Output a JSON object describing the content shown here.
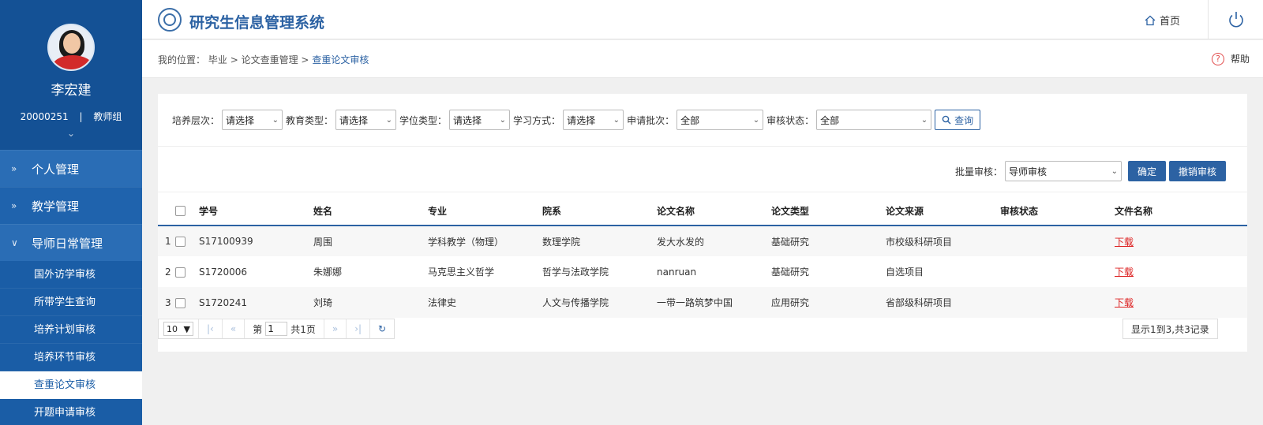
{
  "app_title": "研究生信息管理系统",
  "header": {
    "home_label": "首页",
    "help_label": "帮助"
  },
  "user": {
    "name": "李宏建",
    "id": "20000251",
    "role": "教师组",
    "separator": "|"
  },
  "sidebar": {
    "menus": [
      {
        "label": "个人管理",
        "icon": "double-chevron-right-icon"
      },
      {
        "label": "教学管理",
        "icon": "double-chevron-right-icon"
      },
      {
        "label": "导师日常管理",
        "icon": "double-chevron-down-icon"
      }
    ],
    "sub_items": [
      {
        "label": "国外访学审核"
      },
      {
        "label": "所带学生查询"
      },
      {
        "label": "培养计划审核"
      },
      {
        "label": "培养环节审核"
      },
      {
        "label": "查重论文审核"
      },
      {
        "label": "开题申请审核"
      }
    ]
  },
  "breadcrumb": {
    "prefix": "我的位置：",
    "items": [
      "毕业",
      "论文查重管理"
    ],
    "current": "查重论文审核",
    "sep": ">"
  },
  "filters": [
    {
      "label": "培养层次：",
      "value": "请选择"
    },
    {
      "label": "教育类型：",
      "value": "请选择"
    },
    {
      "label": "学位类型：",
      "value": "请选择"
    },
    {
      "label": "学习方式：",
      "value": "请选择"
    },
    {
      "label": "申请批次：",
      "value": "全部"
    },
    {
      "label": "审核状态：",
      "value": "全部"
    }
  ],
  "query_button": "查询",
  "batch": {
    "label": "批量审核：",
    "value": "导师审核",
    "confirm": "确定",
    "revoke": "撤销审核"
  },
  "table": {
    "headers": [
      "学号",
      "姓名",
      "专业",
      "院系",
      "论文名称",
      "论文类型",
      "论文来源",
      "审核状态",
      "文件名称"
    ],
    "rows": [
      {
        "index": "1",
        "student_id": "S17100939",
        "name": "周围",
        "major": "学科教学（物理）",
        "dept": "数理学院",
        "title": "发大水发的",
        "type": "基础研究",
        "source": "市校级科研项目",
        "status": "",
        "file": "下载"
      },
      {
        "index": "2",
        "student_id": "S1720006",
        "name": "朱娜娜",
        "major": "马克思主义哲学",
        "dept": "哲学与法政学院",
        "title": "nanruan",
        "type": "基础研究",
        "source": "自选项目",
        "status": "",
        "file": "下载"
      },
      {
        "index": "3",
        "student_id": "S1720241",
        "name": "刘琦",
        "major": "法律史",
        "dept": "人文与传播学院",
        "title": "一带一路筑梦中国",
        "type": "应用研究",
        "source": "省部级科研项目",
        "status": "",
        "file": "下载"
      }
    ]
  },
  "pager": {
    "page_size": "10",
    "page_prefix": "第",
    "page_value": "1",
    "total_pages": "共1页",
    "summary": "显示1到3,共3记录"
  },
  "colors": {
    "sidebar": "#1a5da6",
    "accent": "#2c62a3",
    "download": "#dd2222"
  }
}
